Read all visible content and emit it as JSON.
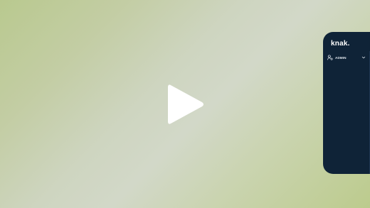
{
  "video": {
    "play_icon": "play-icon"
  },
  "sidebar": {
    "logo_text": "knak",
    "logo_dot": ".",
    "account_label": "ADMIN",
    "account_icon": "user-cog-icon",
    "account_chevron": "chevron-down-icon"
  },
  "colors": {
    "panel_bg": "#0f2337",
    "accent": "#ffffff"
  }
}
